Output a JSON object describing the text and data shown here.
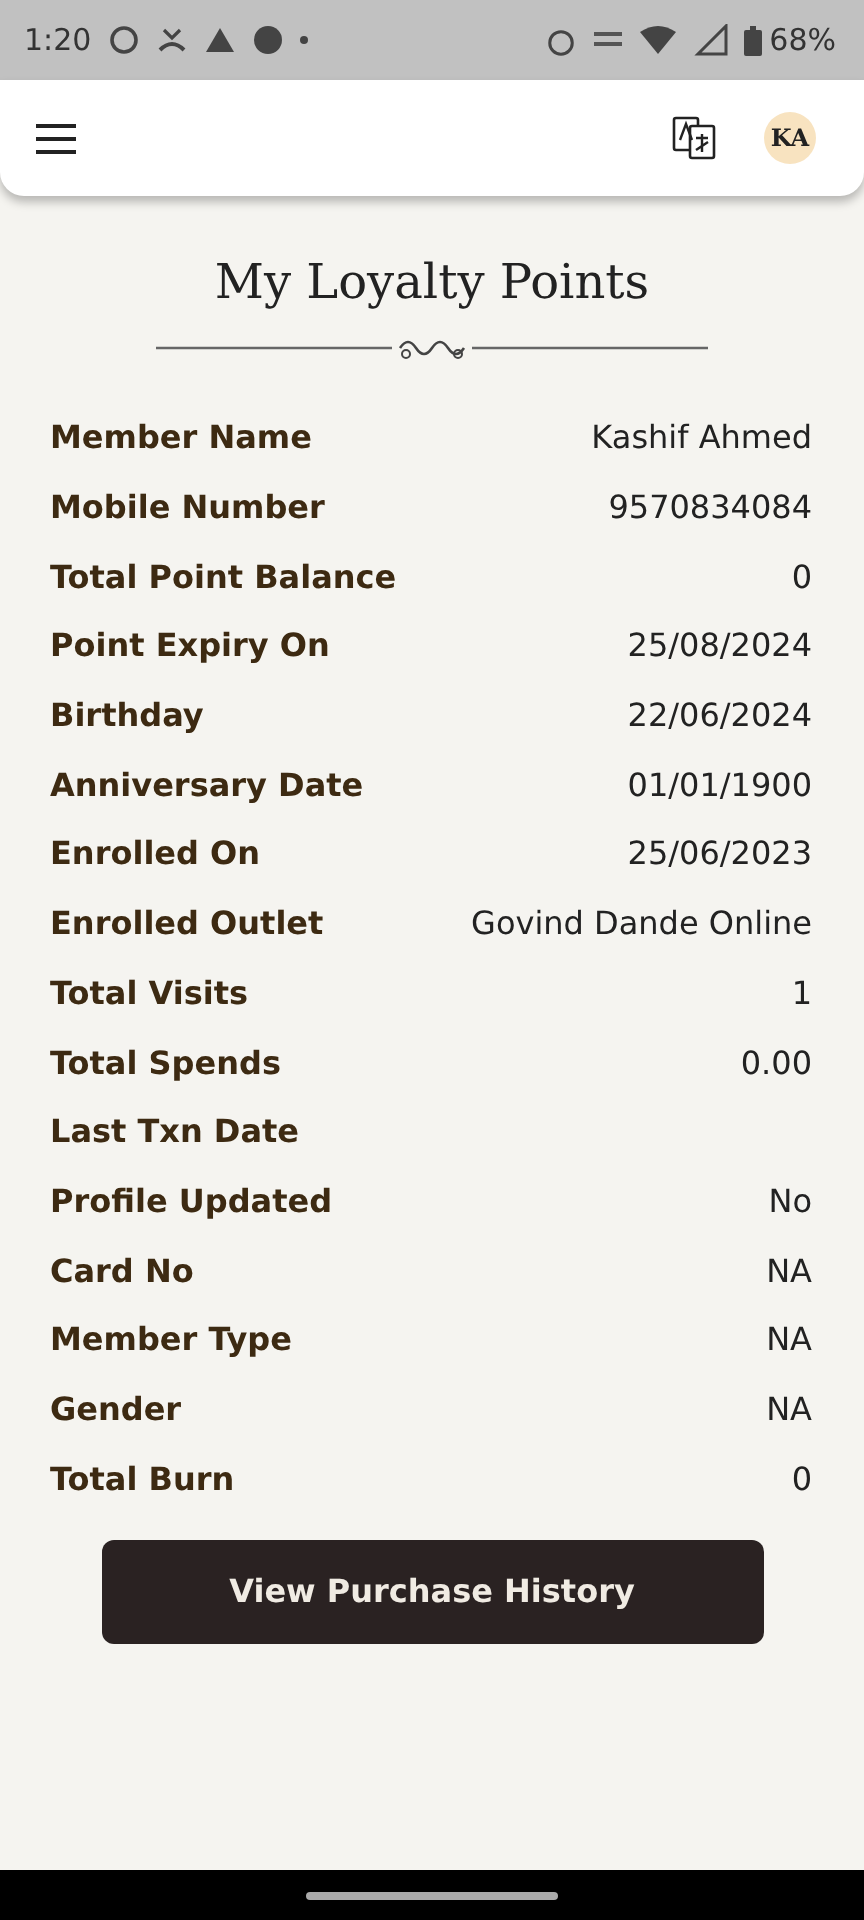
{
  "status_bar": {
    "time": "1:20",
    "battery": "68%"
  },
  "header": {
    "avatar": "KA"
  },
  "title": "My Loyalty Points",
  "details": [
    {
      "label": "Member Name",
      "value": "Kashif Ahmed"
    },
    {
      "label": "Mobile Number",
      "value": "9570834084"
    },
    {
      "label": "Total Point Balance",
      "value": "0"
    },
    {
      "label": "Point Expiry On",
      "value": "25/08/2024"
    },
    {
      "label": "Birthday",
      "value": "22/06/2024"
    },
    {
      "label": "Anniversary Date",
      "value": "01/01/1900"
    },
    {
      "label": "Enrolled On",
      "value": "25/06/2023"
    },
    {
      "label": "Enrolled Outlet",
      "value": "Govind Dande Online"
    },
    {
      "label": "Total Visits",
      "value": "1"
    },
    {
      "label": "Total Spends",
      "value": "0.00"
    },
    {
      "label": "Last Txn Date"
    },
    {
      "label": "Profile Updated",
      "value": "No"
    },
    {
      "label": "Card No",
      "value": "NA"
    },
    {
      "label": "Member Type",
      "value": "NA"
    },
    {
      "label": "Gender",
      "value": "NA"
    },
    {
      "label": "Total Burn",
      "value": "0"
    }
  ],
  "button": "View Purchase History"
}
